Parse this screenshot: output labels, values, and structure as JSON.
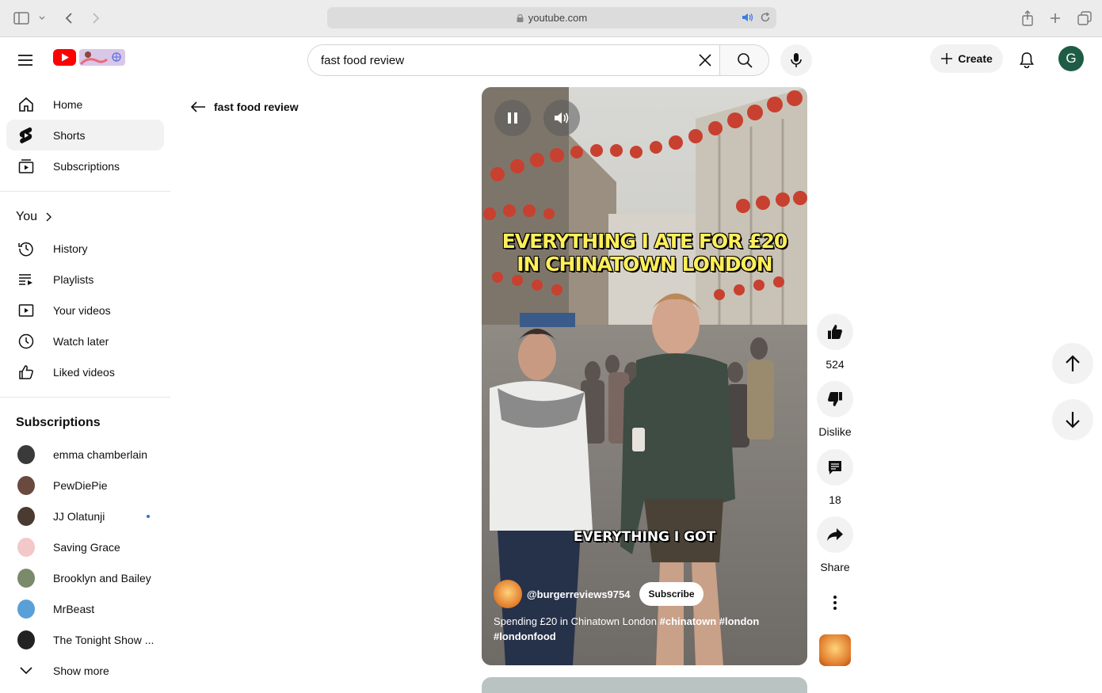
{
  "browser": {
    "url": "youtube.com",
    "icons": [
      "sidebar-icon",
      "chevron-down-icon",
      "back-icon",
      "forward-icon",
      "lock-icon",
      "audio-icon",
      "reload-icon",
      "share-icon",
      "new-tab-icon",
      "tabs-icon"
    ]
  },
  "header": {
    "search_value": "fast food review",
    "create_label": "Create",
    "avatar_letter": "G"
  },
  "sidebar": {
    "main": [
      {
        "label": "Home",
        "icon": "home-icon"
      },
      {
        "label": "Shorts",
        "icon": "shorts-icon",
        "active": true
      },
      {
        "label": "Subscriptions",
        "icon": "subscriptions-icon"
      }
    ],
    "you_heading": "You",
    "you": [
      {
        "label": "History",
        "icon": "history-icon"
      },
      {
        "label": "Playlists",
        "icon": "playlists-icon"
      },
      {
        "label": "Your videos",
        "icon": "your-videos-icon"
      },
      {
        "label": "Watch later",
        "icon": "clock-icon"
      },
      {
        "label": "Liked videos",
        "icon": "thumb-up-icon"
      }
    ],
    "subscriptions_heading": "Subscriptions",
    "subscriptions": [
      {
        "label": "emma chamberlain",
        "color": "#3a3a3a"
      },
      {
        "label": "PewDiePie",
        "color": "#6a4a3f"
      },
      {
        "label": "JJ Olatunji",
        "color": "#4a3a30",
        "live": true
      },
      {
        "label": "Saving Grace",
        "color": "#e8a4a4"
      },
      {
        "label": "Brooklyn and Bailey",
        "color": "#7a8a6a"
      },
      {
        "label": "MrBeast",
        "color": "#5aa0d8"
      },
      {
        "label": "The Tonight Show ...",
        "color": "#222222"
      }
    ],
    "show_more": "Show more"
  },
  "back_nav": {
    "label": "fast food review"
  },
  "video": {
    "caption_top_1": "EVERYTHING I ATE FOR £20",
    "caption_top_2": "IN CHINATOWN LONDON",
    "caption_mid": "EVERYTHING I GOT",
    "channel": "@burgerreviews9754",
    "subscribe": "Subscribe",
    "title_text": "Spending £20 in Chinatown London ",
    "tag1": "#chinatown",
    "tag2": "#london",
    "tag3": "#londonfood"
  },
  "actions": {
    "likes": "524",
    "dislike": "Dislike",
    "comments": "18",
    "share": "Share"
  },
  "colors": {
    "accent": "#ff0000",
    "text": "#0f0f0f",
    "chip_bg": "#f2f2f2"
  }
}
